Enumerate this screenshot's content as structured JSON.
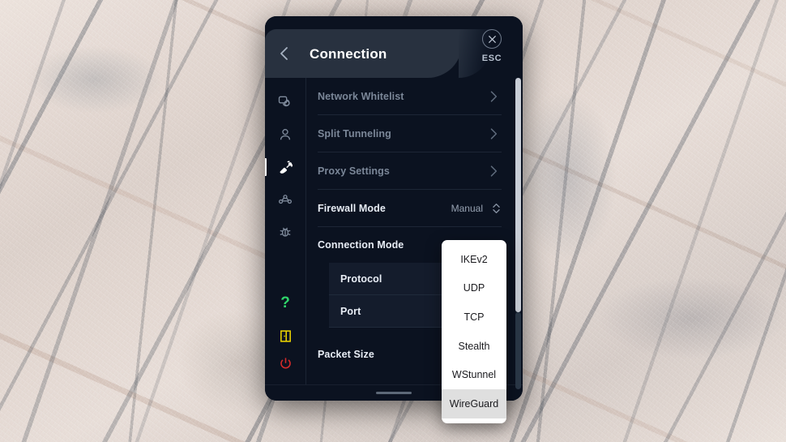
{
  "wallpaper": {
    "description": "marble-stone-texture"
  },
  "panel": {
    "header": {
      "back_icon": "chevron-left-icon",
      "title": "Connection",
      "close_icon": "close-circle-icon",
      "esc_label": "ESC"
    },
    "sidebar": {
      "items": [
        {
          "icon": "screens-icon",
          "name": "sidebar-item-general",
          "active": false
        },
        {
          "icon": "user-icon",
          "name": "sidebar-item-account",
          "active": false
        },
        {
          "icon": "satellite-dish-icon",
          "name": "sidebar-item-connection",
          "active": true
        },
        {
          "icon": "share-nodes-icon",
          "name": "sidebar-item-network",
          "active": false
        },
        {
          "icon": "bug-icon",
          "name": "sidebar-item-diagnostics",
          "active": false
        }
      ],
      "bottom": [
        {
          "icon": "question-mark-icon",
          "name": "sidebar-help",
          "glyph": "?",
          "color": "#2fd46a"
        },
        {
          "icon": "exit-door-icon",
          "name": "sidebar-exit",
          "color": "#ecd400"
        },
        {
          "icon": "power-icon",
          "name": "sidebar-power",
          "color": "#d42a2a"
        }
      ]
    },
    "settings": [
      {
        "label": "Network Whitelist",
        "type": "nav",
        "dim": true
      },
      {
        "label": "Split Tunneling",
        "type": "nav",
        "dim": true
      },
      {
        "label": "Proxy Settings",
        "type": "nav",
        "dim": true
      },
      {
        "label": "Firewall Mode",
        "type": "select",
        "value": "Manual",
        "dim": false
      },
      {
        "label": "Connection Mode",
        "type": "group",
        "dim": false
      },
      {
        "label": "Protocol",
        "type": "sub",
        "dim": false
      },
      {
        "label": "Port",
        "type": "sub",
        "dim": false
      },
      {
        "label": "Packet Size",
        "type": "plain",
        "dim": false
      }
    ],
    "scrollbar": {
      "name": "vertical-scrollbar"
    },
    "drag_handle": {
      "name": "resize-handle"
    }
  },
  "dropdown": {
    "name": "protocol-dropdown",
    "options": [
      {
        "label": "IKEv2",
        "selected": false
      },
      {
        "label": "UDP",
        "selected": false
      },
      {
        "label": "TCP",
        "selected": false
      },
      {
        "label": "Stealth",
        "selected": false
      },
      {
        "label": "WStunnel",
        "selected": false
      },
      {
        "label": "WireGuard",
        "selected": true
      }
    ]
  },
  "colors": {
    "panel_bg": "#0b1220",
    "header_bg": "#28313f",
    "accent_white": "#ffffff",
    "help_green": "#2fd46a",
    "exit_yellow": "#ecd400",
    "power_red": "#d42a2a",
    "dropdown_bg": "#ffffff",
    "dropdown_selected": "#dfdfdf"
  }
}
